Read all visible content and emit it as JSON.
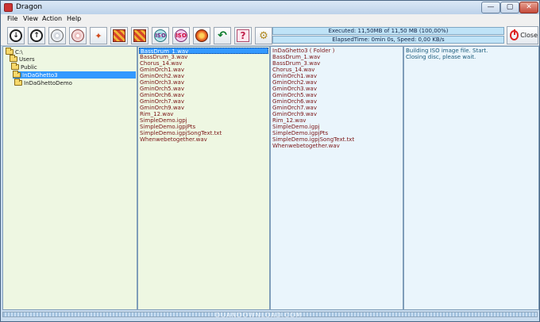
{
  "window": {
    "title": "Dragon",
    "min_glyph": "—",
    "max_glyph": "▢",
    "close_glyph": "✕"
  },
  "menu": [
    "File",
    "View",
    "Action",
    "Help"
  ],
  "toolbar": {
    "buttons": [
      {
        "name": "down-arrow-icon",
        "glyph": "↓"
      },
      {
        "name": "up-arrow-icon",
        "glyph": "↑"
      },
      {
        "name": "disc-erase-icon",
        "glyph": ""
      },
      {
        "name": "disc-red-icon",
        "glyph": ""
      },
      {
        "name": "burn-flame-icon",
        "glyph": "✦"
      },
      {
        "name": "grid-icon",
        "glyph": ""
      },
      {
        "name": "grid-cross-icon",
        "glyph": ""
      },
      {
        "name": "iso-disc-icon",
        "glyph": "ISO"
      },
      {
        "name": "iso-disc-red-icon",
        "glyph": "ISO"
      },
      {
        "name": "burn-disc-icon",
        "glyph": ""
      },
      {
        "name": "undo-icon",
        "glyph": "↶"
      },
      {
        "name": "help-icon",
        "glyph": "?"
      },
      {
        "name": "settings-gears-icon",
        "glyph": "⚙"
      }
    ]
  },
  "status": {
    "executed": "Executed: 11,50MB of 11,50 MB (100,00%)",
    "elapsed": "ElapsedTime: 0min 0s, Speed: 0,00 KB/s",
    "close_label": "Close"
  },
  "tree": [
    {
      "label": "C:\\",
      "indent": 0,
      "selected": false
    },
    {
      "label": "Users",
      "indent": 1,
      "selected": false
    },
    {
      "label": "Public",
      "indent": 2,
      "selected": false
    },
    {
      "label": "InDaGhetto3",
      "indent": 3,
      "selected": true
    },
    {
      "label": "InDaGhettoDemo",
      "indent": 4,
      "selected": false
    }
  ],
  "files": [
    "BassDrum_1.wav",
    "BassDrum_3.wav",
    "Chorus_14.wav",
    "GminOrch1.wav",
    "GminOrch2.wav",
    "GminOrch3.wav",
    "GminOrch5.wav",
    "GminOrch6.wav",
    "GminOrch7.wav",
    "GminOrch9.wav",
    "Rim_12.wav",
    "SimpleDemo.igpj",
    "SimpleDemo.igpjPts",
    "SimpleDemo.igpjSongText.txt",
    "Whenwebetogether.wav"
  ],
  "iso_files": [
    "InDaGhetto3 ( Folder )",
    "BassDrum_1.wav",
    "BassDrum_3.wav",
    "Chorus_14.wav",
    "GminOrch1.wav",
    "GminOrch2.wav",
    "GminOrch3.wav",
    "GminOrch5.wav",
    "GminOrch6.wav",
    "GminOrch7.wav",
    "GminOrch9.wav",
    "Rim_12.wav",
    "SimpleDemo.igpj",
    "SimpleDemo.igpjPts",
    "SimpleDemo.igpjSongText.txt",
    "Whenwebetogether.wav"
  ],
  "log": [
    "Building ISO image file. Start.",
    "Closing disc, please wait."
  ],
  "watermark": "DUANDOWNLOAD.COM"
}
